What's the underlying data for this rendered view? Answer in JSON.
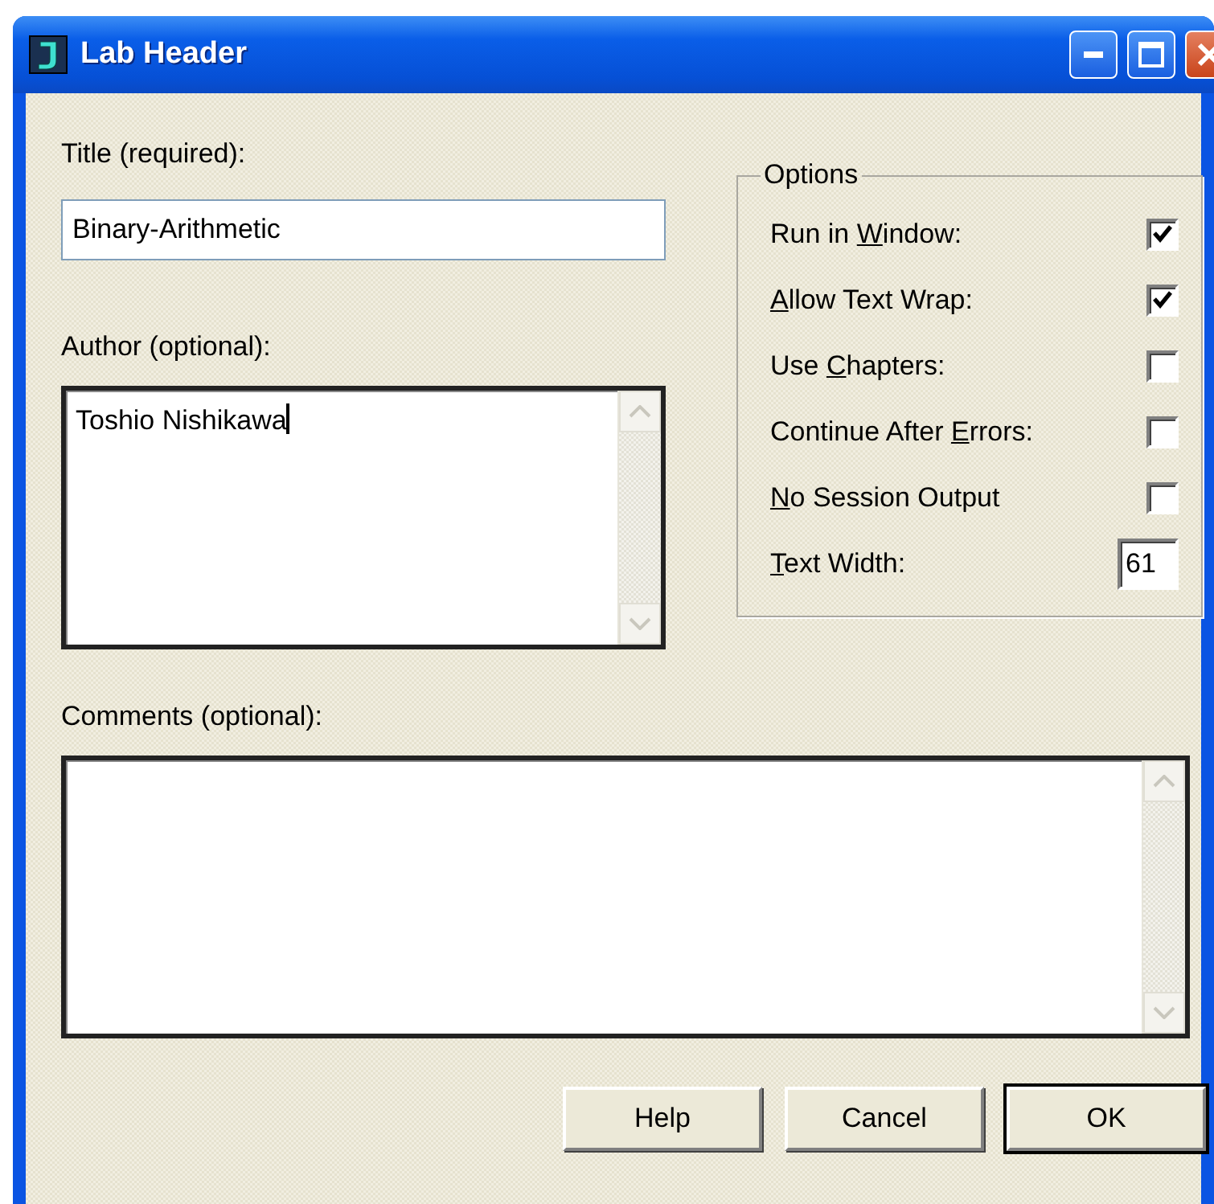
{
  "window": {
    "title": "Lab Header"
  },
  "title_field": {
    "label": "Title (required):",
    "value": "Binary-Arithmetic"
  },
  "author_field": {
    "label": "Author (optional):",
    "value": "Toshio Nishikawa"
  },
  "options": {
    "title": "Options",
    "items": [
      {
        "kind": "checkbox",
        "label": {
          "before": "Run in ",
          "key": "W",
          "after": "indow:"
        },
        "checked": true
      },
      {
        "kind": "checkbox",
        "label": {
          "key": "A",
          "after": "llow Text Wrap:"
        },
        "checked": true
      },
      {
        "kind": "checkbox",
        "label": {
          "before": "Use ",
          "key": "C",
          "after": "hapters:"
        },
        "checked": false
      },
      {
        "kind": "checkbox",
        "label": {
          "before": "Continue After ",
          "key": "E",
          "after": "rrors:"
        },
        "checked": false
      },
      {
        "kind": "checkbox",
        "label": {
          "key": "N",
          "after": "o Session Output"
        },
        "checked": false
      },
      {
        "kind": "number",
        "label": {
          "key": "T",
          "after": "ext Width:"
        },
        "value": "61"
      }
    ]
  },
  "comments_field": {
    "label": "Comments (optional):"
  },
  "buttons": [
    {
      "label": "Help",
      "default": false
    },
    {
      "label": "Cancel",
      "default": false
    },
    {
      "label": "OK",
      "default": true
    }
  ]
}
